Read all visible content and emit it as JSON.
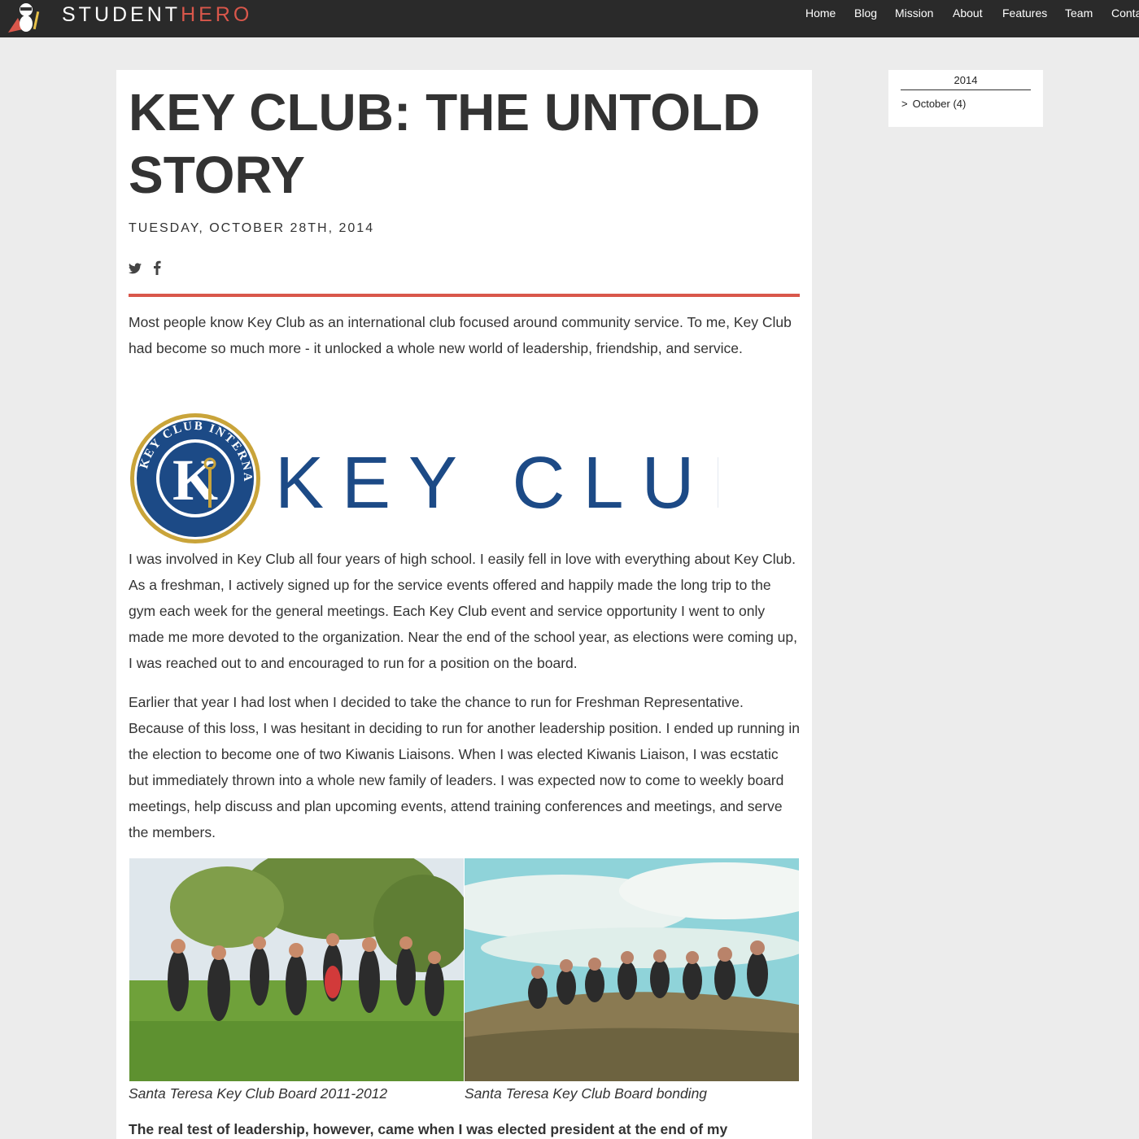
{
  "header": {
    "brand_part1": "STUDENT",
    "brand_part2": "HERO",
    "nav": [
      "Home",
      "Blog",
      "Mission",
      "About",
      "Features",
      "Team",
      "Conta"
    ]
  },
  "article": {
    "title": "KEY CLUB: THE UNTOLD STORY",
    "date": "TUESDAY, OCTOBER 28TH, 2014",
    "intro": "Most people know Key Club as an international club focused around community service. To me, Key Club had become so much more - it unlocked a whole new world of leadership, friendship, and service.",
    "logo_text": "KEY CLUB",
    "logo_ring_text": "KEY CLUB INTERNATIONAL",
    "paragraph1": "I was involved in Key Club all four years of high school. I easily fell in love with everything about Key Club. As a freshman, I actively signed up for the service events offered and happily made the long trip to the gym each week for the general meetings. Each Key Club event and service opportunity I went to only made me more devoted to the organization. Near the end of the school year, as elections were coming up, I was reached out to and encouraged to run for a position on the board.",
    "paragraph2": "Earlier that year I had lost when I decided to take the chance to run for Freshman Representative. Because of this loss, I was hesitant in deciding to run for another leadership position. I ended up running in the election to become one of two Kiwanis Liaisons. When I was elected Kiwanis Liaison, I was ecstatic but immediately thrown into a whole new family of leaders. I was expected now to come to weekly board meetings, help discuss and plan upcoming events, attend training conferences and meetings, and serve the members.",
    "caption1": "Santa Teresa Key Club Board 2011-2012",
    "caption2": "Santa Teresa Key Club Board bonding",
    "paragraph3": "The real test of leadership, however, came when I was elected president at the end of my sophomore"
  },
  "sidebar": {
    "year": "2014",
    "chevron": ">",
    "month": "October (4)"
  },
  "colors": {
    "accent": "#d9574b",
    "topbar": "#2a2a2a",
    "keyclub_blue": "#1c4a86",
    "keyclub_gold": "#c9a43a"
  }
}
